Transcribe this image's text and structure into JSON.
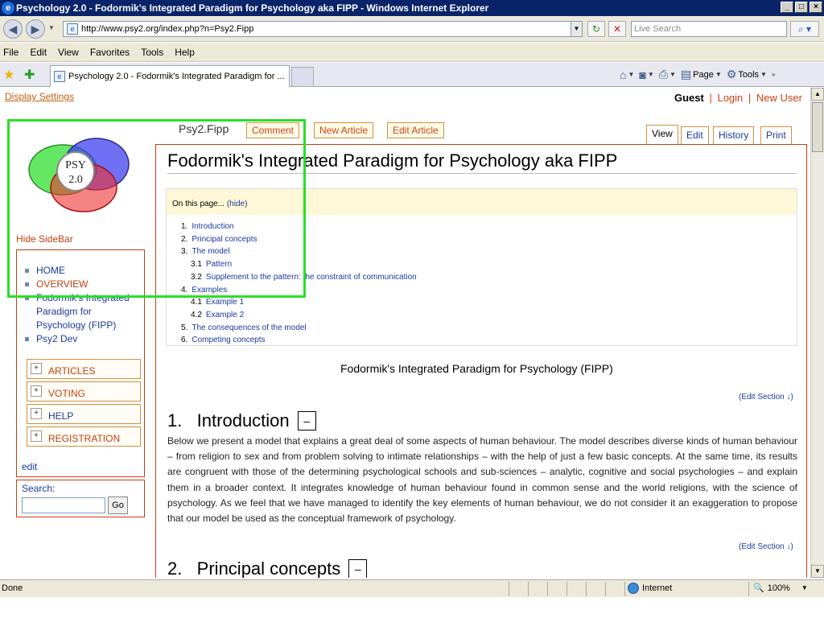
{
  "window": {
    "title": "Psychology 2.0 - Fodormik's Integrated Paradigm for Psychology aka FIPP - Windows Internet Explorer",
    "ie_letter": "e"
  },
  "browser": {
    "url": "http://www.psy2.org/index.php?n=Psy2.Fipp",
    "search_placeholder": "Live Search",
    "menu": [
      "File",
      "Edit",
      "View",
      "Favorites",
      "Tools",
      "Help"
    ],
    "tab_title": "Psychology 2.0 - Fodormik's Integrated Paradigm for ...",
    "cmd_page": "Page",
    "cmd_tools": "Tools",
    "status_done": "Done",
    "status_zone": "Internet",
    "zoom": "100%"
  },
  "page": {
    "display_settings": "Display Settings",
    "user": {
      "guest": "Guest",
      "login": "Login",
      "new_user": "New User"
    },
    "logo_text_1": "PSY",
    "logo_text_2": "2.0",
    "page_name": "Psy2.Fipp",
    "actions": {
      "comment": "Comment",
      "new_article": "New Article",
      "edit_article": "Edit Article"
    },
    "tabs": {
      "view": "View",
      "edit": "Edit",
      "history": "History",
      "print": "Print"
    },
    "sidebar": {
      "toggle": "Hide SideBar",
      "links": [
        "HOME",
        "OVERVIEW",
        "Fodormik's Integrated Paradigm for Psychology (FIPP)",
        "Psy2 Dev"
      ],
      "accordions": [
        "ARTICLES",
        "VOTING",
        "HELP",
        "REGISTRATION"
      ],
      "edit": "edit",
      "search_label": "Search:",
      "search_go": "Go"
    },
    "article": {
      "title": "Fodormik's Integrated Paradigm for Psychology aka FIPP",
      "toc_head": "On this page...",
      "toc_hide": "(hide)",
      "toc": [
        {
          "num": "1.",
          "label": "Introduction",
          "sub": false
        },
        {
          "num": "2.",
          "label": "Principal concepts",
          "sub": false
        },
        {
          "num": "3.",
          "label": "The model",
          "sub": false
        },
        {
          "num": "3.1",
          "label": "Pattern",
          "sub": true
        },
        {
          "num": "3.2",
          "label": "Supplement to the pattern: the constraint of communication",
          "sub": true
        },
        {
          "num": "4.",
          "label": "Examples",
          "sub": false
        },
        {
          "num": "4.1",
          "label": "Example 1",
          "sub": true
        },
        {
          "num": "4.2",
          "label": "Example 2",
          "sub": true
        },
        {
          "num": "5.",
          "label": "The consequences of the model",
          "sub": false
        },
        {
          "num": "6.",
          "label": "Competing concepts",
          "sub": false
        }
      ],
      "figure_caption": "Fodormik's Integrated Paradigm for Psychology (FIPP)",
      "edit_section": "(Edit Section ↓)",
      "h_intro": "1.   Introduction",
      "h_principal": "2.   Principal concepts",
      "collapse": "–",
      "intro_text": "Below we present a model that explains a great deal of some aspects of human behaviour. The model describes diverse kinds of human behaviour – from religion to sex and from problem solving to intimate relationships – with the help of just a few basic concepts. At the same time, its results are congruent with those of the determining psychological schools and sub-sciences – analytic, cognitive and social psychologies – and explain them in a broader context. It integrates knowledge of human behaviour found in common sense and the world religions, with the science of psychology. As we feel that we have managed to identify the key elements of human behaviour, we do not consider it an exaggeration to propose that our model be used as the conceptual framework of psychology."
    }
  }
}
